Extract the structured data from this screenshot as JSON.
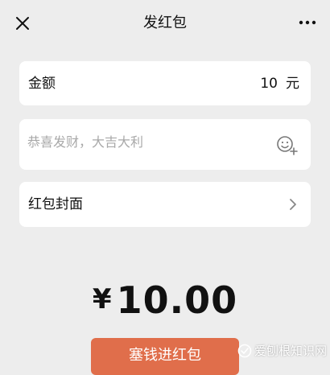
{
  "nav": {
    "title": "发红包",
    "close_icon": "close-icon",
    "more_icon": "more-icon"
  },
  "amount": {
    "label": "金额",
    "value": "10",
    "unit": "元"
  },
  "greeting": {
    "placeholder": "恭喜发财，大吉大利",
    "value": "",
    "emoji_icon": "emoji-add-icon"
  },
  "cover": {
    "label": "红包封面",
    "chevron_icon": "chevron-right-icon"
  },
  "summary": {
    "currency": "¥",
    "amount": "10.00"
  },
  "send_button": {
    "label": "塞钱进红包",
    "color": "#e06e4b"
  },
  "watermark": {
    "text": "爱刨根知识网"
  },
  "colors": {
    "background": "#ededed",
    "card": "#ffffff",
    "placeholder": "#a8a8a8"
  }
}
